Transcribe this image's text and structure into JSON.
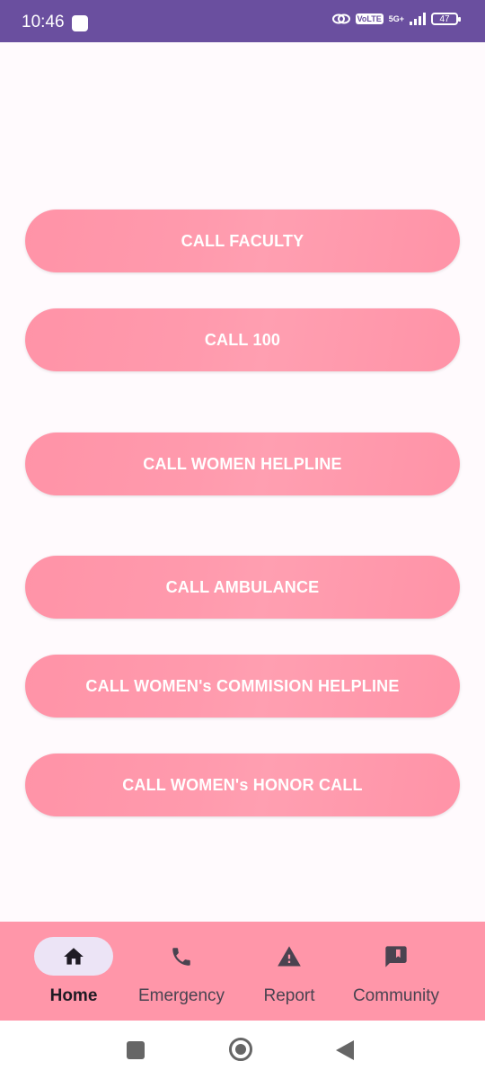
{
  "status_bar": {
    "time": "10:46",
    "network": "5G+",
    "battery": "47"
  },
  "buttons": [
    {
      "label": "CALL FACULTY"
    },
    {
      "label": "CALL 100"
    },
    {
      "label": "CALL WOMEN HELPLINE"
    },
    {
      "label": "CALL AMBULANCE"
    },
    {
      "label": "CALL WOMEN's COMMISION HELPLINE"
    },
    {
      "label": "CALL WOMEN's HONOR CALL"
    }
  ],
  "bottom_nav": {
    "items": [
      {
        "label": "Home",
        "icon": "home-icon",
        "active": true
      },
      {
        "label": "Emergency",
        "icon": "phone-icon",
        "active": false
      },
      {
        "label": "Report",
        "icon": "warning-icon",
        "active": false
      },
      {
        "label": "Community",
        "icon": "feedback-icon",
        "active": false
      }
    ]
  },
  "colors": {
    "status_bar": "#6a4f9f",
    "button_pink": "#ff96a9",
    "nav_active_pill": "#ece4f6",
    "background": "#fffafd"
  }
}
